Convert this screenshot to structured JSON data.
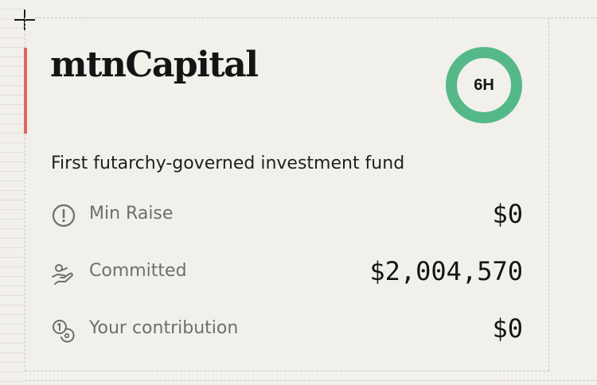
{
  "fund": {
    "name": "mtnCapital",
    "description": "First futarchy-governed investment fund",
    "timer": {
      "label": "6H",
      "ring_color": "#55b888",
      "progress": 1.0
    },
    "accent_color": "#e26561"
  },
  "stats": [
    {
      "icon": "alert-circle-icon",
      "label": "Min Raise",
      "value": "$0"
    },
    {
      "icon": "hand-coins-icon",
      "label": "Committed",
      "value": "$2,004,570"
    },
    {
      "icon": "coins-icon",
      "label": "Your contribution",
      "value": "$0"
    }
  ]
}
